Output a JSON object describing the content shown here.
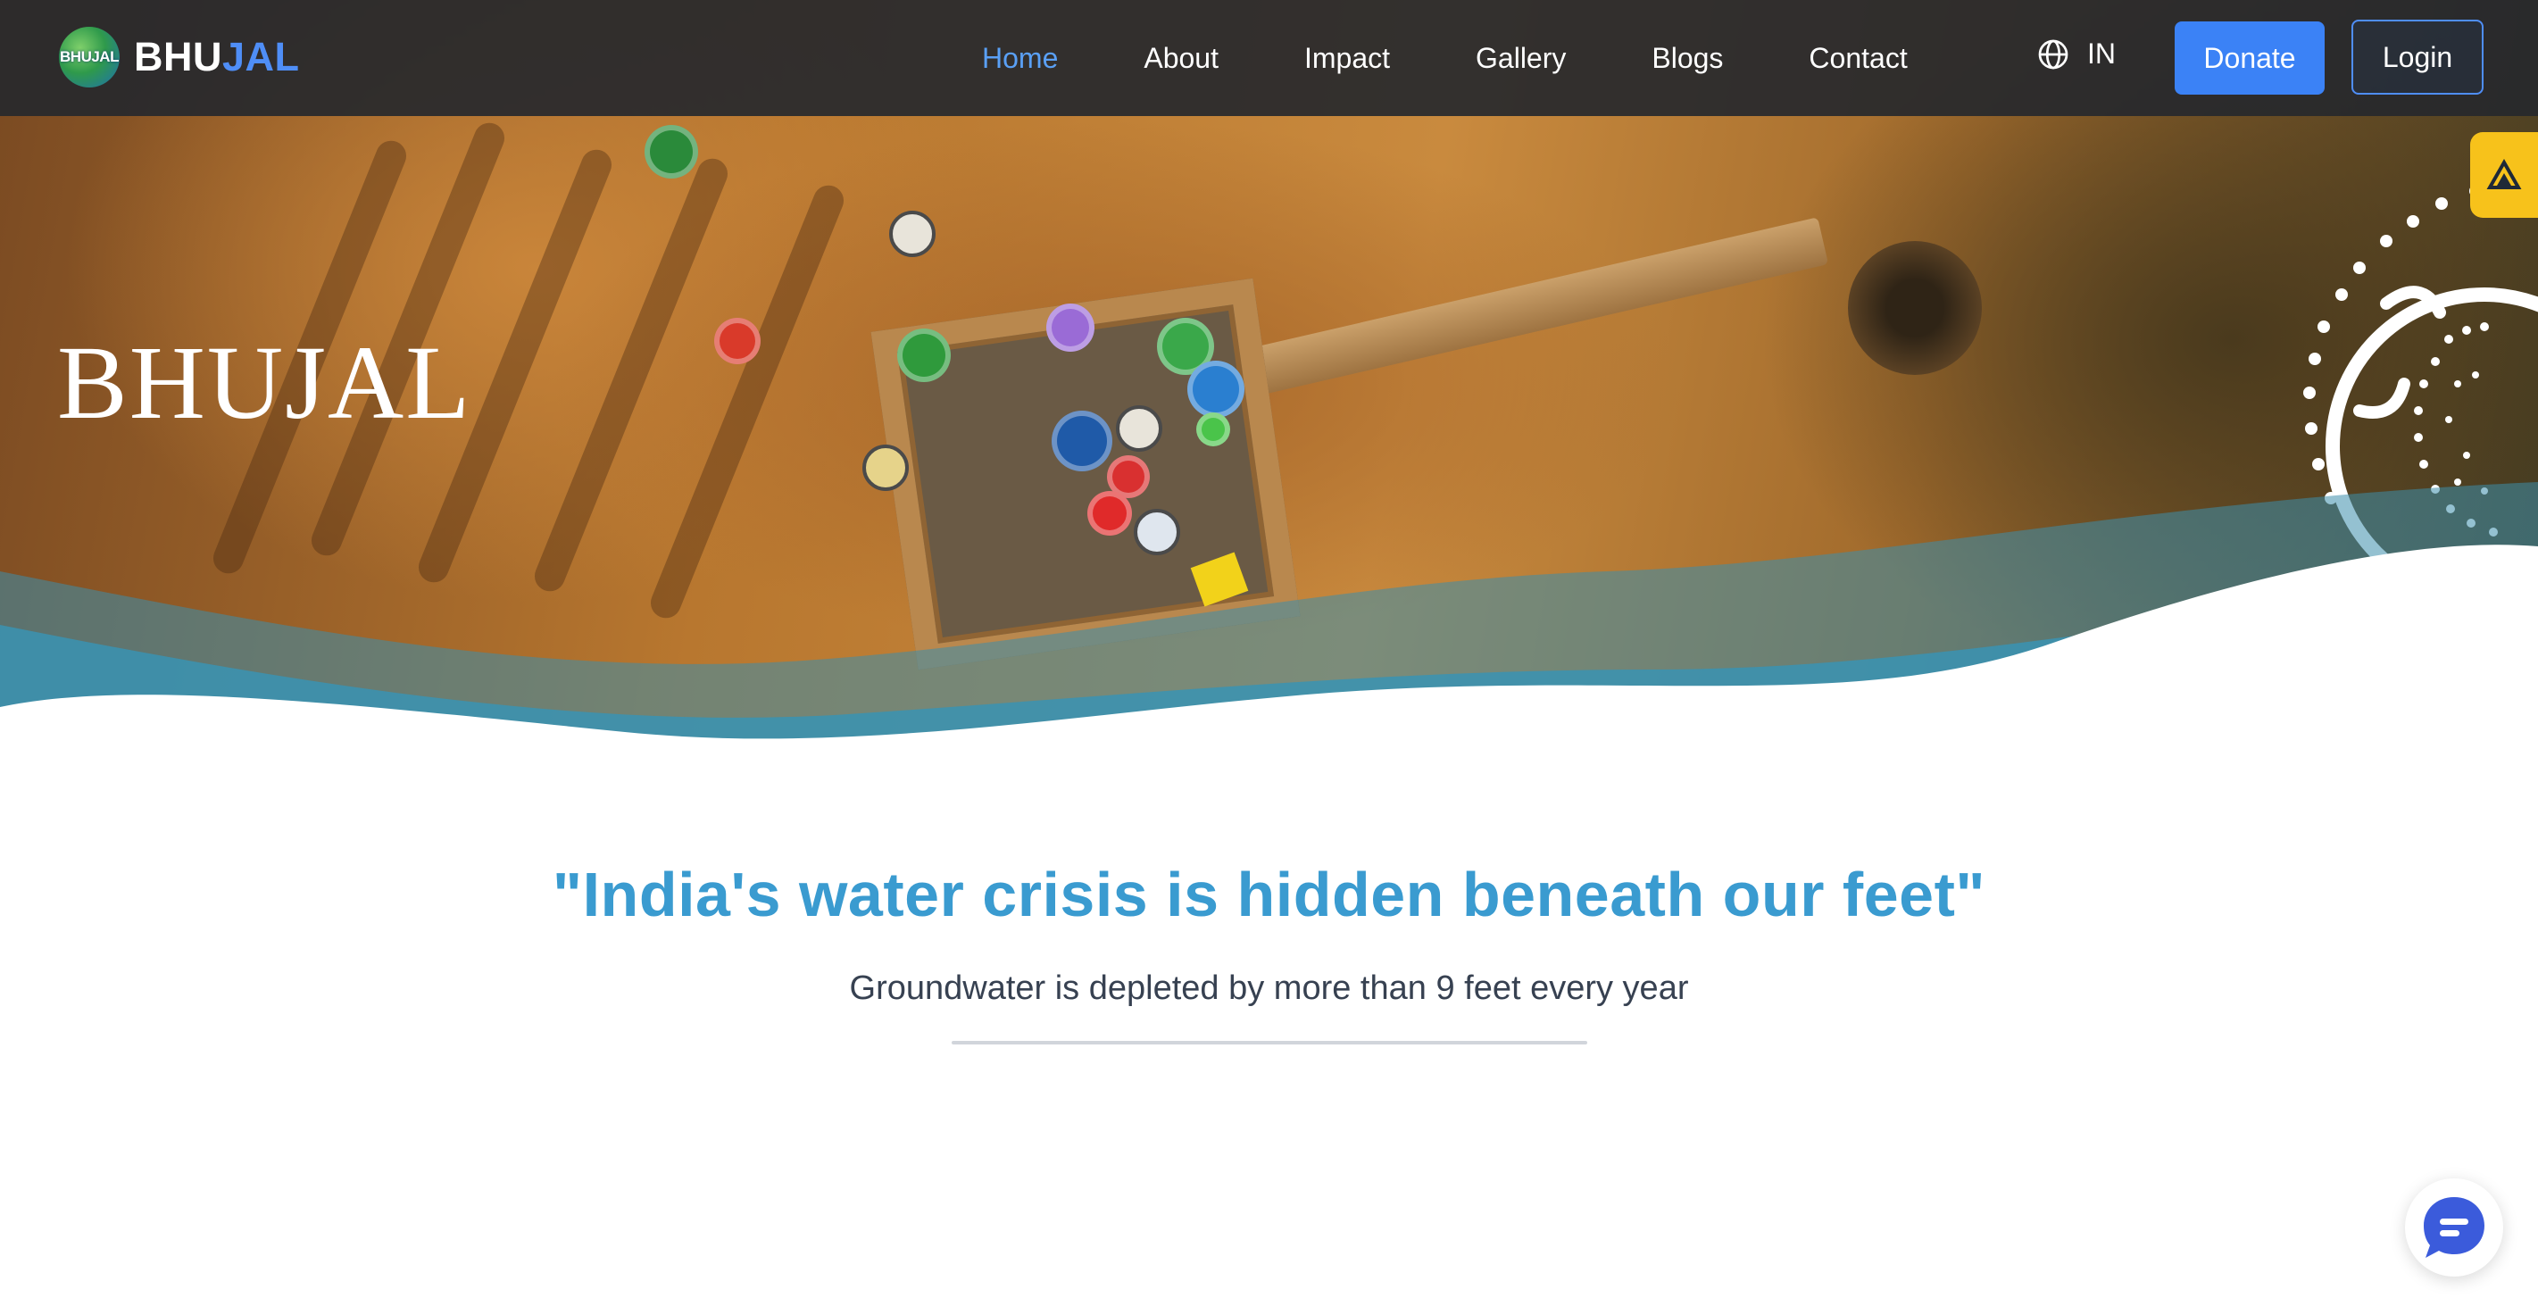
{
  "brand": {
    "logo_text": "BHUJAL",
    "name_part1": "BHU",
    "name_part2": "JAL"
  },
  "nav": {
    "links": [
      {
        "label": "Home",
        "active": true
      },
      {
        "label": "About"
      },
      {
        "label": "Impact"
      },
      {
        "label": "Gallery"
      },
      {
        "label": "Blogs"
      },
      {
        "label": "Contact"
      }
    ],
    "language": {
      "icon": "globe-icon",
      "label": "IN"
    },
    "donate_label": "Donate",
    "login_label": "Login"
  },
  "hero": {
    "title": "BHUJAL",
    "side_badge_icon": "triangle-logo-icon"
  },
  "content": {
    "quote": "\"India's water crisis is hidden beneath our feet\"",
    "subline": "Groundwater is depleted by more than 9 feet every year"
  },
  "chat": {
    "icon": "chat-bubble-icon"
  },
  "colors": {
    "nav_bg": "#26282c",
    "accent_blue": "#3b82f6",
    "active_link": "#5aa0f5",
    "quote_blue": "#3a9bd0",
    "water_teal": "#3a8fae",
    "badge_yellow": "#f7c21b"
  }
}
